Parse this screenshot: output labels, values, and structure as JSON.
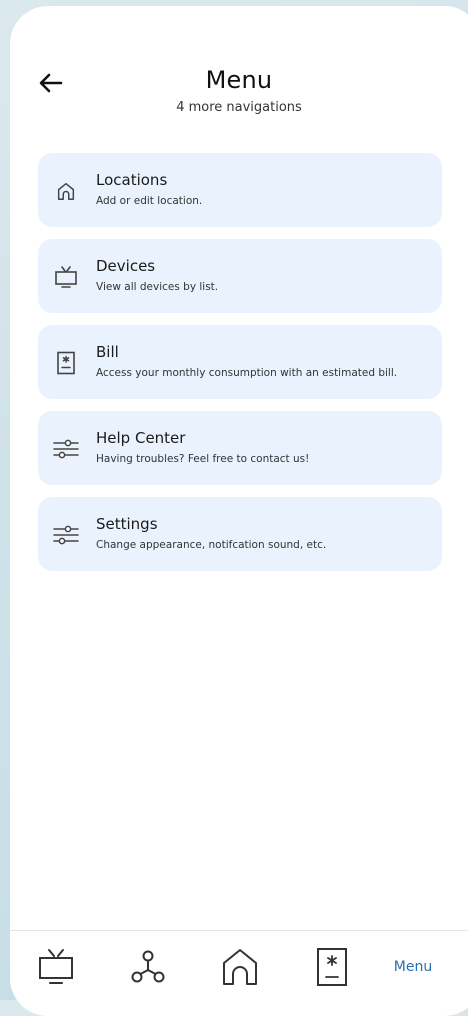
{
  "header": {
    "back_icon": "arrow-left-icon",
    "title": "Menu",
    "subtitle": "4 more navigations"
  },
  "menu": {
    "items": [
      {
        "icon": "home-icon",
        "title": "Locations",
        "description": "Add or edit location."
      },
      {
        "icon": "tv-icon",
        "title": "Devices",
        "description": "View all devices by list."
      },
      {
        "icon": "bill-icon",
        "title": "Bill",
        "description": "Access your monthly consumption with  an estimated bill."
      },
      {
        "icon": "sliders-icon",
        "title": "Help Center",
        "description": "Having troubles? Feel free to contact us!"
      },
      {
        "icon": "sliders-icon",
        "title": "Settings",
        "description": "Change appearance, notifcation sound, etc."
      }
    ]
  },
  "bottom_nav": {
    "items": [
      {
        "icon": "tv-icon"
      },
      {
        "icon": "network-icon"
      },
      {
        "icon": "home-icon"
      },
      {
        "icon": "bill-icon"
      },
      {
        "label": "Menu",
        "active": true
      }
    ],
    "active_color": "#2b6fb0"
  },
  "colors": {
    "card_background": "#eaf3fd",
    "page_background": "#ffffff",
    "outer_background": "#cfe2e8"
  }
}
